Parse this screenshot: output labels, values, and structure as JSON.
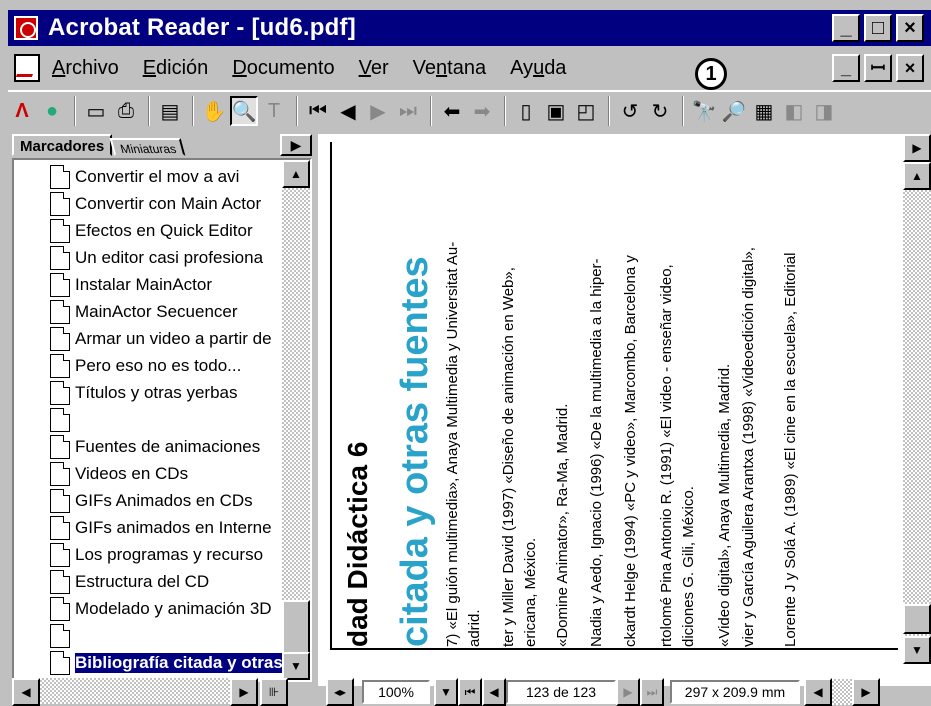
{
  "window": {
    "title": "Acrobat Reader - [ud6.pdf]",
    "min": "_",
    "max": "□",
    "close": "×"
  },
  "menu": {
    "items": [
      "Archivo",
      "Edición",
      "Documento",
      "Ver",
      "Ventana",
      "Ayuda"
    ],
    "child_min": "_",
    "child_restore": "ꟷ",
    "child_close": "×"
  },
  "callout": "1",
  "toolbar": {
    "icons": [
      "acrobat-icon",
      "globe-icon",
      "open-icon",
      "print-icon",
      "thumbnails-icon",
      "hand-tool-icon",
      "zoom-tool-icon",
      "text-select-icon",
      "first-page-icon",
      "prev-page-icon",
      "next-page-icon",
      "last-page-icon",
      "go-back-icon",
      "go-forward-icon",
      "actual-size-icon",
      "fit-page-icon",
      "fit-width-icon",
      "rotate-left-icon",
      "rotate-right-icon",
      "find-icon",
      "find-again-icon",
      "search-icon",
      "prev-result-icon",
      "next-result-icon"
    ]
  },
  "panel": {
    "tab_bookmarks": "Marcadores",
    "tab_thumbnails": "Miniaturas",
    "bookmarks": [
      "Convertir el mov a avi",
      "Convertir con Main Actor",
      "Efectos en Quick Editor",
      "Un editor casi profesiona",
      "Instalar MainActor",
      "MainActor Secuencer",
      "Armar un video a partir de",
      "Pero eso no es todo...",
      "Títulos y otras yerbas",
      "",
      "Fuentes de animaciones",
      "Videos en CDs",
      "GIFs Animados en CDs",
      "GIFs animados en Interne",
      "Los programas y recurso",
      "Estructura del CD",
      "Modelado y animación 3D",
      "",
      "Bibliografía citada y otras"
    ]
  },
  "doc": {
    "heading1": "dad Didáctica 6",
    "heading2": "citada y otras fuentes",
    "lines": [
      "7) «El guión multimedia», Anaya Multimedia y Universitat Au-",
      "adrid.",
      "ter y Miller David (1997) «Diseño de animación en Web»,",
      "ericana, México.",
      "«Domine Animator», Ra-Ma, Madrid.",
      "Nadia y Aedo, Ignacio (1996) «De la multimedia a la hiper-",
      "ckardt Helge (1994) «PC y video», Marcombo, Barcelona y",
      "rtolomé Pina Antonio R. (1991) «El video - enseñar video,",
      "diciones G. Gili, México.",
      "«Video digital», Anaya Multimedia, Madrid.",
      "vier y García Aguilera Arantxa (1998) «Videoedición digital»,",
      "Lorente J y Solá A. (1989) «El cine en la escuela», Editorial"
    ]
  },
  "status": {
    "zoom": "100%",
    "page": "123 de 123",
    "size": "297 x 209.9  mm"
  },
  "colors": {
    "titlebar": "#000080",
    "accent": "#29a3c9",
    "chrome": "#c0c0c0"
  }
}
